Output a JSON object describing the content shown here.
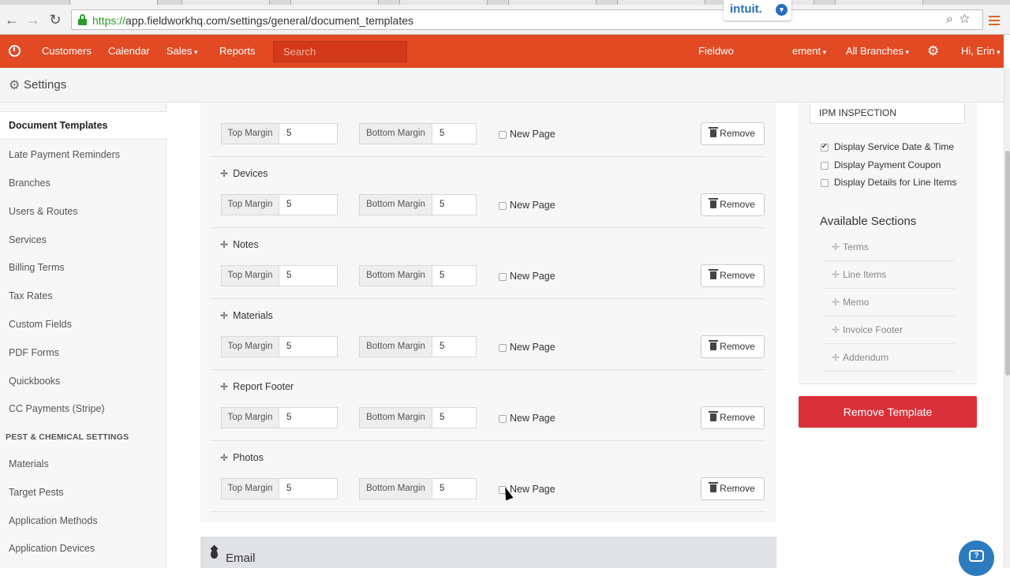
{
  "browser": {
    "url_scheme": "https://",
    "url_rest": "app.fieldworkhq.com/settings/general/document_templates",
    "back_glyph": "←",
    "forward_glyph": "→",
    "reload_glyph": "↻",
    "url_icons": "⌕☆"
  },
  "appbar": {
    "nav": [
      "Customers",
      "Calendar",
      "Sales",
      "Reports"
    ],
    "search_placeholder": "Search",
    "intuit": "intuit.",
    "intuit_caret": "▾",
    "company": "Fieldwo",
    "company_tail": "ement",
    "branches": "All Branches",
    "gear_glyph": "⚙",
    "user": "Hi, Erin"
  },
  "settings": {
    "title": "Settings",
    "gear_glyph": "⚙"
  },
  "sidebar": {
    "active": "Document Templates",
    "items": [
      "Late Payment Reminders",
      "Branches",
      "Users & Routes",
      "Services",
      "Billing Terms",
      "Tax Rates",
      "Custom Fields",
      "PDF Forms",
      "Quickbooks",
      "CC Payments (Stripe)"
    ],
    "heading": "PEST & CHEMICAL SETTINGS",
    "items2": [
      "Materials",
      "Target Pests",
      "Application Methods",
      "Application Devices"
    ]
  },
  "sections": {
    "move_glyph": "✛",
    "top_margin_label": "Top Margin",
    "bottom_margin_label": "Bottom Margin",
    "new_page_label": "New Page",
    "remove_label": "Remove",
    "rows": [
      {
        "name": "",
        "top": "5",
        "bottom": "5",
        "new_page": false
      },
      {
        "name": "Devices",
        "top": "5",
        "bottom": "5",
        "new_page": false
      },
      {
        "name": "Notes",
        "top": "5",
        "bottom": "5",
        "new_page": false
      },
      {
        "name": "Materials",
        "top": "5",
        "bottom": "5",
        "new_page": false
      },
      {
        "name": "Report Footer",
        "top": "5",
        "bottom": "5",
        "new_page": false
      },
      {
        "name": "Photos",
        "top": "5",
        "bottom": "5",
        "new_page": false
      }
    ]
  },
  "email": {
    "title": "Email"
  },
  "right": {
    "template_name": "IPM INSPECTION",
    "options": [
      {
        "label": "Display Service Date & Time",
        "checked": true
      },
      {
        "label": "Display Payment Coupon",
        "checked": false
      },
      {
        "label": "Display Details for Line Items",
        "checked": false
      }
    ],
    "available_title": "Available Sections",
    "available": [
      "Terms",
      "Line Items",
      "Memo",
      "Invoice Footer",
      "Addendum"
    ],
    "remove_template": "Remove Template"
  },
  "chat": {
    "glyph": "?"
  }
}
